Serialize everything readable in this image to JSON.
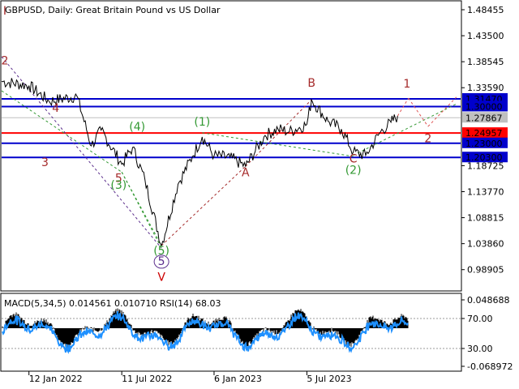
{
  "chart_data": {
    "type": "line",
    "title": "GBPUSD, Daily:  Great Britain Pound vs US Dollar",
    "yticks": [
      1.48455,
      1.435,
      1.38545,
      1.3359,
      1.27867,
      1.18725,
      1.1377,
      1.08815,
      1.0386,
      0.98905
    ],
    "ylim": [
      0.95,
      1.5
    ],
    "xticks": [
      {
        "label": "12 Jan 2022",
        "date": "2022-01-12"
      },
      {
        "label": "11 Jul 2022",
        "date": "2022-07-11"
      },
      {
        "label": "6 Jan 2023",
        "date": "2023-01-06"
      },
      {
        "label": "5 Jul 2023",
        "date": "2023-07-05"
      }
    ],
    "price_series": {
      "dates": [
        "2021-11-20",
        "2022-01-12",
        "2022-02-20",
        "2022-04-15",
        "2022-05-13",
        "2022-06-01",
        "2022-07-11",
        "2022-08-01",
        "2022-08-25",
        "2022-09-26",
        "2022-10-28",
        "2022-11-25",
        "2022-12-14",
        "2023-01-06",
        "2023-02-06",
        "2023-03-08",
        "2023-04-15",
        "2023-05-10",
        "2023-06-01",
        "2023-07-05",
        "2023-07-14",
        "2023-08-15",
        "2023-09-10",
        "2023-10-03",
        "2023-10-27",
        "2023-11-25",
        "2023-12-15",
        "2023-12-28"
      ],
      "close": [
        1.348,
        1.34,
        1.31,
        1.32,
        1.225,
        1.255,
        1.19,
        1.222,
        1.16,
        1.035,
        1.152,
        1.205,
        1.242,
        1.206,
        1.203,
        1.186,
        1.245,
        1.257,
        1.252,
        1.266,
        1.313,
        1.272,
        1.257,
        1.213,
        1.207,
        1.252,
        1.27,
        1.282
      ]
    },
    "levels": [
      {
        "value": 1.3147,
        "label": "1.31470",
        "color": "#0000cc"
      },
      {
        "value": 1.3,
        "label": "1.30000",
        "color": "#0000cc"
      },
      {
        "value": 1.27867,
        "label": "1.27867",
        "color": "#c0c0c0"
      },
      {
        "value": 1.24957,
        "label": "1.24957",
        "color": "#ff0000"
      },
      {
        "value": 1.23,
        "label": "1.23000",
        "color": "#0000cc"
      },
      {
        "value": 1.203,
        "label": "1.20300",
        "color": "#0000cc"
      }
    ],
    "wave_labels": [
      {
        "text": "I",
        "date": "2021-11-20",
        "value": 1.475,
        "color": "#a52a2a"
      },
      {
        "text": "2",
        "date": "2021-11-20",
        "value": 1.38,
        "color": "#a52a2a"
      },
      {
        "text": "4",
        "date": "2022-03-05",
        "value": 1.29,
        "color": "#a52a2a"
      },
      {
        "text": "3",
        "date": "2022-02-12",
        "value": 1.186,
        "color": "#a52a2a"
      },
      {
        "text": "5",
        "date": "2022-07-05",
        "value": 1.156,
        "color": "#a52a2a"
      },
      {
        "text": "V",
        "date": "2022-09-26",
        "value": 0.968,
        "color": "#cc0000"
      },
      {
        "text": "(4)",
        "date": "2022-08-10",
        "value": 1.254,
        "color": "#339933"
      },
      {
        "text": "(3)",
        "date": "2022-07-05",
        "value": 1.143,
        "color": "#339933"
      },
      {
        "text": "(5)",
        "date": "2022-09-26",
        "value": 1.018,
        "color": "#339933"
      },
      {
        "text": "5",
        "date": "2022-09-26",
        "value": 0.998,
        "color": "#5b2d8c"
      },
      {
        "text": "(1)",
        "date": "2022-12-14",
        "value": 1.264,
        "color": "#339933"
      },
      {
        "text": "A",
        "date": "2023-03-08",
        "value": 1.167,
        "color": "#a52a2a"
      },
      {
        "text": "B",
        "date": "2023-07-14",
        "value": 1.338,
        "color": "#a52a2a"
      },
      {
        "text": "C",
        "date": "2023-10-03",
        "value": 1.193,
        "color": "#a52a2a"
      },
      {
        "text": "(2)",
        "date": "2023-10-03",
        "value": 1.172,
        "color": "#339933"
      },
      {
        "text": "1",
        "date": "2024-01-15",
        "value": 1.336,
        "color": "#a52a2a"
      },
      {
        "text": "2",
        "date": "2024-02-25",
        "value": 1.232,
        "color": "#a52a2a"
      }
    ],
    "forecast_path": {
      "dates": [
        "2023-12-28",
        "2024-01-18",
        "2024-02-25",
        "2024-04-20"
      ],
      "values": [
        1.282,
        1.316,
        1.262,
        1.318
      ]
    },
    "indicator": {
      "label": "MACD(5,34,5) 0.014561 0.010710 RSI(14) 68.03",
      "yticks": [
        "0.048688",
        "70.00",
        "30.00",
        "-0.068972"
      ]
    }
  }
}
